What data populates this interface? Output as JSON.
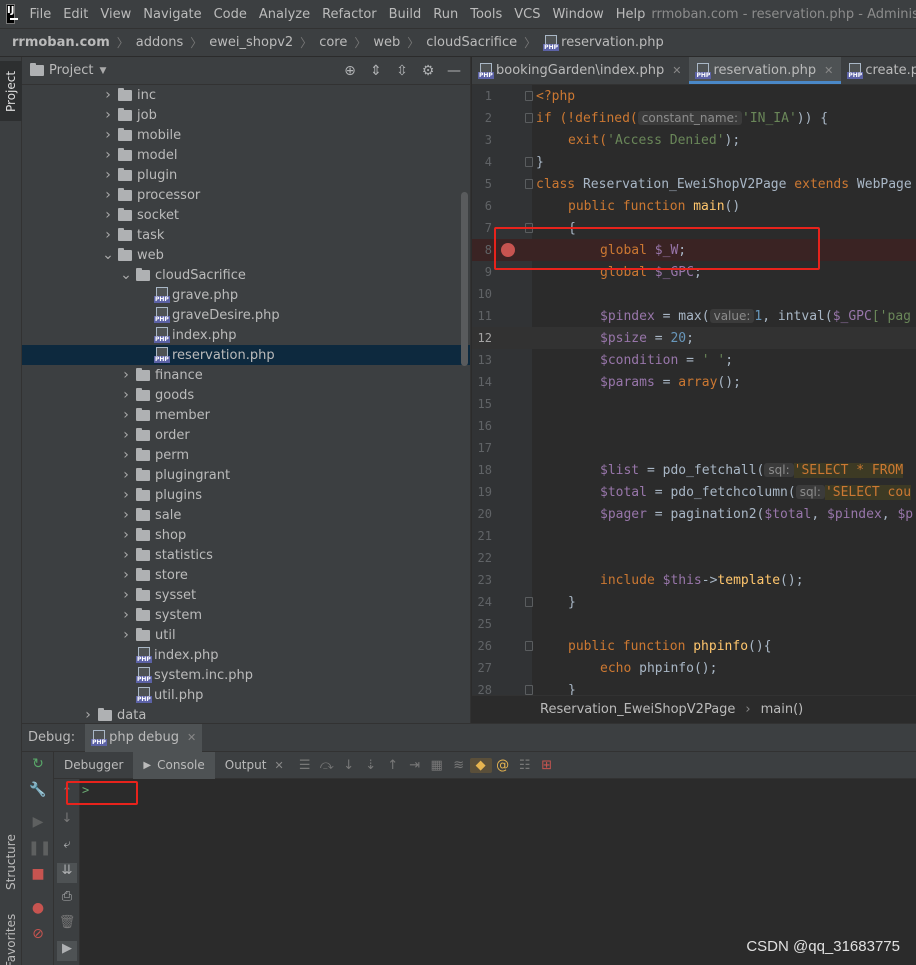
{
  "menubar": {
    "items": [
      "File",
      "Edit",
      "View",
      "Navigate",
      "Code",
      "Analyze",
      "Refactor",
      "Build",
      "Run",
      "Tools",
      "VCS",
      "Window",
      "Help"
    ],
    "window_title": "rrmoban.com - reservation.php - Administrator"
  },
  "breadcrumbs": [
    "rrmoban.com",
    "addons",
    "ewei_shopv2",
    "core",
    "web",
    "cloudSacrifice",
    "reservation.php"
  ],
  "project": {
    "title": "Project",
    "tree": [
      {
        "label": "inc",
        "level": 0,
        "type": "folder",
        "expanded": false
      },
      {
        "label": "job",
        "level": 0,
        "type": "folder",
        "expanded": false
      },
      {
        "label": "mobile",
        "level": 0,
        "type": "folder",
        "expanded": false
      },
      {
        "label": "model",
        "level": 0,
        "type": "folder",
        "expanded": false
      },
      {
        "label": "plugin",
        "level": 0,
        "type": "folder",
        "expanded": false
      },
      {
        "label": "processor",
        "level": 0,
        "type": "folder",
        "expanded": false
      },
      {
        "label": "socket",
        "level": 0,
        "type": "folder",
        "expanded": false
      },
      {
        "label": "task",
        "level": 0,
        "type": "folder",
        "expanded": false
      },
      {
        "label": "web",
        "level": 0,
        "type": "folder",
        "expanded": true
      },
      {
        "label": "cloudSacrifice",
        "level": 1,
        "type": "folder",
        "expanded": true
      },
      {
        "label": "grave.php",
        "level": 2,
        "type": "php"
      },
      {
        "label": "graveDesire.php",
        "level": 2,
        "type": "php"
      },
      {
        "label": "index.php",
        "level": 2,
        "type": "php"
      },
      {
        "label": "reservation.php",
        "level": 2,
        "type": "php",
        "selected": true
      },
      {
        "label": "finance",
        "level": 1,
        "type": "folder",
        "expanded": false
      },
      {
        "label": "goods",
        "level": 1,
        "type": "folder",
        "expanded": false
      },
      {
        "label": "member",
        "level": 1,
        "type": "folder",
        "expanded": false
      },
      {
        "label": "order",
        "level": 1,
        "type": "folder",
        "expanded": false
      },
      {
        "label": "perm",
        "level": 1,
        "type": "folder",
        "expanded": false
      },
      {
        "label": "plugingrant",
        "level": 1,
        "type": "folder",
        "expanded": false
      },
      {
        "label": "plugins",
        "level": 1,
        "type": "folder",
        "expanded": false
      },
      {
        "label": "sale",
        "level": 1,
        "type": "folder",
        "expanded": false
      },
      {
        "label": "shop",
        "level": 1,
        "type": "folder",
        "expanded": false
      },
      {
        "label": "statistics",
        "level": 1,
        "type": "folder",
        "expanded": false
      },
      {
        "label": "store",
        "level": 1,
        "type": "folder",
        "expanded": false
      },
      {
        "label": "sysset",
        "level": 1,
        "type": "folder",
        "expanded": false
      },
      {
        "label": "system",
        "level": 1,
        "type": "folder",
        "expanded": false
      },
      {
        "label": "util",
        "level": 1,
        "type": "folder",
        "expanded": false
      },
      {
        "label": "index.php",
        "level": 1,
        "type": "php"
      },
      {
        "label": "system.inc.php",
        "level": 1,
        "type": "php"
      },
      {
        "label": "util.php",
        "level": 1,
        "type": "php"
      },
      {
        "label": "data",
        "level": -1,
        "type": "folder",
        "expanded": false
      }
    ]
  },
  "editor": {
    "tabs": [
      {
        "label": "bookingGarden\\index.php",
        "active": false,
        "closable": true
      },
      {
        "label": "reservation.php",
        "active": true,
        "closable": true
      },
      {
        "label": "create.php",
        "active": false,
        "closable": false
      }
    ],
    "line_numbers": [
      "1",
      "2",
      "3",
      "4",
      "5",
      "6",
      "7",
      "8",
      "9",
      "10",
      "11",
      "12",
      "13",
      "14",
      "15",
      "16",
      "17",
      "18",
      "19",
      "20",
      "21",
      "22",
      "23",
      "24",
      "25",
      "26",
      "27",
      "28"
    ],
    "hints": {
      "constant_name": "constant_name:",
      "value": "value:",
      "sql": "sql:"
    },
    "code": {
      "l1": "<?php",
      "l2a": "if (!defined(",
      "l2b": "'IN_IA'",
      "l2c": ")) {",
      "l3a": "exit(",
      "l3b": "'Access Denied'",
      "l3c": ");",
      "l4": "}",
      "l5a": "class ",
      "l5b": "Reservation_EweiShopV2Page ",
      "l5c": "extends ",
      "l5d": "WebPage",
      "l6a": "public function ",
      "l6b": "main",
      "l6c": "()",
      "l7": "{",
      "l8a": "global ",
      "l8b": "$_W",
      "l8c": ";",
      "l9a": "global ",
      "l9b": "$_GPC",
      "l9c": ";",
      "l11a": "$pindex",
      "l11b": " = max(",
      "l11c": "1",
      "l11d": ", intval(",
      "l11e": "$_GPC",
      "l11f": "['pag",
      "l12a": "$psize",
      "l12b": " = ",
      "l12c": "20",
      "l12d": ";",
      "l13a": "$condition",
      "l13b": " = ",
      "l13c": "' '",
      "l13d": ";",
      "l14a": "$params",
      "l14b": " = ",
      "l14c": "array",
      "l14d": "();",
      "l18a": "$list",
      "l18b": " = pdo_fetchall(",
      "l18c": "'SELECT * FROM",
      "l19a": "$total",
      "l19b": " = pdo_fetchcolumn(",
      "l19c": "'SELECT cou",
      "l20a": "$pager",
      "l20b": " = pagination2(",
      "l20c": "$total",
      "l20d": ", ",
      "l20e": "$pindex",
      "l20f": ", ",
      "l20g": "$p",
      "l23a": "include ",
      "l23b": "$this",
      "l23c": "->",
      "l23d": "template",
      "l23e": "();",
      "l24": "}",
      "l26a": "public function ",
      "l26b": "phpinfo",
      "l26c": "(){",
      "l27a": "echo ",
      "l27b": "phpinfo",
      "l27c": "();",
      "l28": "}"
    },
    "footer": {
      "class": "Reservation_EweiShopV2Page",
      "method": "main()"
    }
  },
  "debug": {
    "label": "Debug:",
    "session": "php debug",
    "tabs": [
      "Debugger",
      "Console",
      "Output"
    ],
    "prompt": ">"
  },
  "left_tool_windows": [
    "Project",
    "Structure",
    "Favorites"
  ],
  "watermark": "CSDN @qq_31683775",
  "colors": {
    "highlight_box": "#e8231c",
    "breakpoint": "#c75450",
    "selection": "#0d293e",
    "tab_underline": "#4a88c7"
  }
}
